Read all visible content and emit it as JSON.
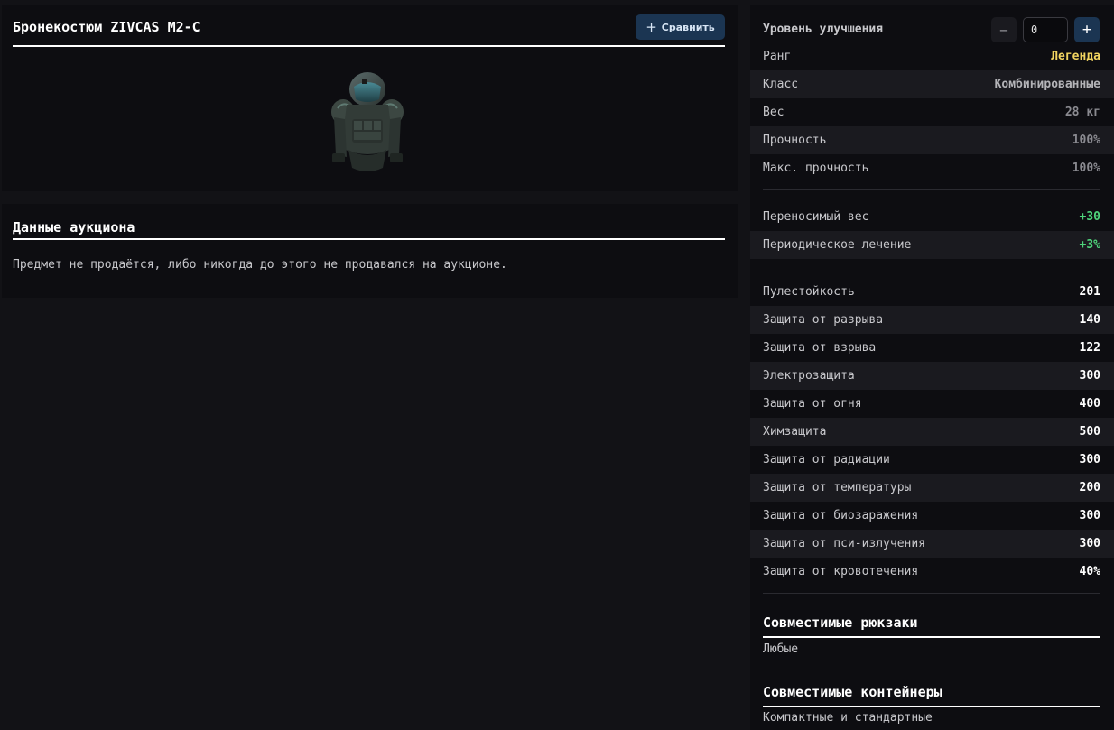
{
  "item": {
    "title": "Бронекостюм ZIVCAS M2-C",
    "compare_label": "Сравнить",
    "image_icon": "armor-suit-image"
  },
  "auction": {
    "title": "Данные аукциона",
    "text": "Предмет не продаётся, либо никогда до этого не продавался на аукционе."
  },
  "upgrade": {
    "label": "Уровень улучшения",
    "value": "0",
    "minus": "−",
    "plus": "+"
  },
  "info_rows": [
    {
      "label": "Ранг",
      "value": "Легенда"
    },
    {
      "label": "Класс",
      "value": "Комбинированные"
    },
    {
      "label": "Вес",
      "value": "28 кг"
    },
    {
      "label": "Прочность",
      "value": "100%"
    },
    {
      "label": "Макс. прочность",
      "value": "100%"
    }
  ],
  "bonus_rows": [
    {
      "label": "Переносимый вес",
      "value": "+30"
    },
    {
      "label": "Периодическое лечение",
      "value": "+3%"
    }
  ],
  "protection_rows": [
    {
      "label": "Пулестойкость",
      "value": "201"
    },
    {
      "label": "Защита от разрыва",
      "value": "140"
    },
    {
      "label": "Защита от взрыва",
      "value": "122"
    },
    {
      "label": "Электрозащита",
      "value": "300"
    },
    {
      "label": "Защита от огня",
      "value": "400"
    },
    {
      "label": "Химзащита",
      "value": "500"
    },
    {
      "label": "Защита от радиации",
      "value": "300"
    },
    {
      "label": "Защита от температуры",
      "value": "200"
    },
    {
      "label": "Защита от биозаражения",
      "value": "300"
    },
    {
      "label": "Защита от пси-излучения",
      "value": "300"
    },
    {
      "label": "Защита от кровотечения",
      "value": "40%"
    }
  ],
  "backpacks": {
    "title": "Совместимые рюкзаки",
    "value": "Любые"
  },
  "containers": {
    "title": "Совместимые контейнеры",
    "value": "Компактные и стандартные"
  },
  "colors": {
    "legend": "#f2d560",
    "bonus": "#4ed37a",
    "accent": "#1b3552"
  }
}
